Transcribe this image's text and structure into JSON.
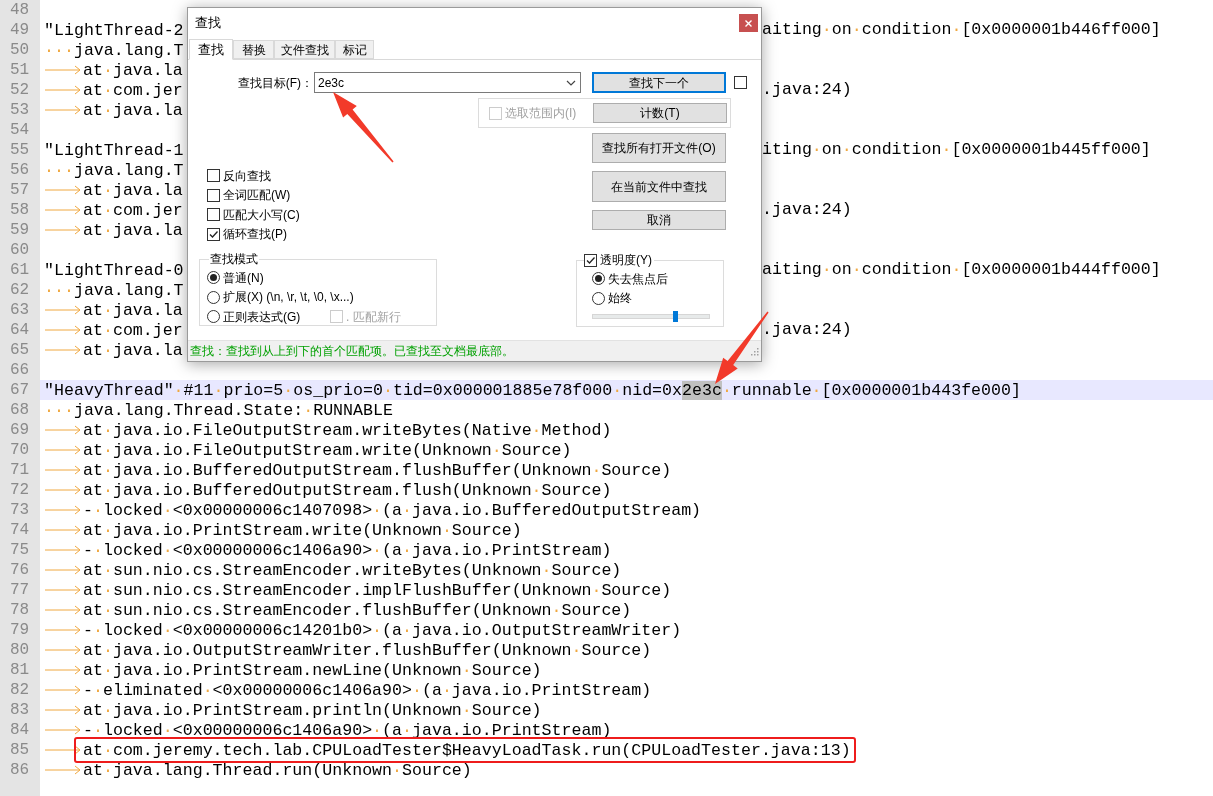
{
  "editor": {
    "lines": [
      {
        "number": "48",
        "tab": false,
        "current": false
      },
      {
        "number": "49",
        "tab": false,
        "current": false,
        "text": "\"LightThread-2",
        "right_text": "aiting·on·condition·[0x0000001b446ff000]"
      },
      {
        "number": "50",
        "tab": false,
        "current": false,
        "text": "···java.lang.T"
      },
      {
        "number": "51",
        "tab": true,
        "current": false,
        "text": "at·java.la"
      },
      {
        "number": "52",
        "tab": true,
        "current": false,
        "text": "at·com.jer",
        "right_text": ".java:24)"
      },
      {
        "number": "53",
        "tab": true,
        "current": false,
        "text": "at·java.la"
      },
      {
        "number": "54",
        "tab": false,
        "current": false
      },
      {
        "number": "55",
        "tab": false,
        "current": false,
        "text": "\"LightThread-1",
        "right_text": "iting·on·condition·[0x0000001b445ff000]"
      },
      {
        "number": "56",
        "tab": false,
        "current": false,
        "text": "···java.lang.T"
      },
      {
        "number": "57",
        "tab": true,
        "current": false,
        "text": "at·java.la"
      },
      {
        "number": "58",
        "tab": true,
        "current": false,
        "text": "at·com.jer",
        "right_text": ".java:24)"
      },
      {
        "number": "59",
        "tab": true,
        "current": false,
        "text": "at·java.la"
      },
      {
        "number": "60",
        "tab": false,
        "current": false
      },
      {
        "number": "61",
        "tab": false,
        "current": false,
        "text": "\"LightThread-0",
        "right_text": "aiting·on·condition·[0x0000001b444ff000]"
      },
      {
        "number": "62",
        "tab": false,
        "current": false,
        "text": "···java.lang.T"
      },
      {
        "number": "63",
        "tab": true,
        "current": false,
        "text": "at·java.la"
      },
      {
        "number": "64",
        "tab": true,
        "current": false,
        "text": "at·com.jer",
        "right_text": ".java:24)"
      },
      {
        "number": "65",
        "tab": true,
        "current": false,
        "text": "at·java.la"
      },
      {
        "number": "66",
        "tab": false,
        "current": false
      },
      {
        "number": "67",
        "tab": false,
        "current": true,
        "segments": [
          {
            "text": "\"HeavyThread\"·#11·prio=5·os_prio=0·tid=0x000001885e78f000·nid=0x",
            "match": false
          },
          {
            "text": "2e3c",
            "match": true
          },
          {
            "text": "·runnable·[0x0000001b443fe000]",
            "match": false
          }
        ]
      },
      {
        "number": "68",
        "tab": false,
        "current": false,
        "text": "···java.lang.Thread.State:·RUNNABLE"
      },
      {
        "number": "69",
        "tab": true,
        "current": false,
        "text": "at·java.io.FileOutputStream.writeBytes(Native·Method)"
      },
      {
        "number": "70",
        "tab": true,
        "current": false,
        "text": "at·java.io.FileOutputStream.write(Unknown·Source)"
      },
      {
        "number": "71",
        "tab": true,
        "current": false,
        "text": "at·java.io.BufferedOutputStream.flushBuffer(Unknown·Source)"
      },
      {
        "number": "72",
        "tab": true,
        "current": false,
        "text": "at·java.io.BufferedOutputStream.flush(Unknown·Source)"
      },
      {
        "number": "73",
        "tab": true,
        "current": false,
        "text": "-·locked·<0x00000006c1407098>·(a·java.io.BufferedOutputStream)"
      },
      {
        "number": "74",
        "tab": true,
        "current": false,
        "text": "at·java.io.PrintStream.write(Unknown·Source)"
      },
      {
        "number": "75",
        "tab": true,
        "current": false,
        "text": "-·locked·<0x00000006c1406a90>·(a·java.io.PrintStream)"
      },
      {
        "number": "76",
        "tab": true,
        "current": false,
        "text": "at·sun.nio.cs.StreamEncoder.writeBytes(Unknown·Source)"
      },
      {
        "number": "77",
        "tab": true,
        "current": false,
        "text": "at·sun.nio.cs.StreamEncoder.implFlushBuffer(Unknown·Source)"
      },
      {
        "number": "78",
        "tab": true,
        "current": false,
        "text": "at·sun.nio.cs.StreamEncoder.flushBuffer(Unknown·Source)"
      },
      {
        "number": "79",
        "tab": true,
        "current": false,
        "text": "-·locked·<0x00000006c14201b0>·(a·java.io.OutputStreamWriter)"
      },
      {
        "number": "80",
        "tab": true,
        "current": false,
        "text": "at·java.io.OutputStreamWriter.flushBuffer(Unknown·Source)"
      },
      {
        "number": "81",
        "tab": true,
        "current": false,
        "text": "at·java.io.PrintStream.newLine(Unknown·Source)"
      },
      {
        "number": "82",
        "tab": true,
        "current": false,
        "text": "-·eliminated·<0x00000006c1406a90>·(a·java.io.PrintStream)"
      },
      {
        "number": "83",
        "tab": true,
        "current": false,
        "text": "at·java.io.PrintStream.println(Unknown·Source)"
      },
      {
        "number": "84",
        "tab": true,
        "current": false,
        "text": "-·locked·<0x00000006c1406a90>·(a·java.io.PrintStream)"
      },
      {
        "number": "85",
        "tab": true,
        "current": false,
        "text": "at·com.jeremy.tech.lab.CPULoadTester$HeavyLoadTask.run(CPULoadTester.java:13)"
      },
      {
        "number": "86",
        "tab": true,
        "current": false,
        "text": "at·java.lang.Thread.run(Unknown·Source)"
      }
    ]
  },
  "find_dialog": {
    "title": "查找",
    "tabs": [
      {
        "label": "查找",
        "selected": true
      },
      {
        "label": "替换",
        "selected": false
      },
      {
        "label": "文件查找",
        "selected": false
      },
      {
        "label": "标记",
        "selected": false
      }
    ],
    "find_label": "查找目标(F)：",
    "find_value": "2e3c",
    "find_next_button": {
      "label": "查找下一个",
      "focused": true
    },
    "side_checkbox": {
      "checked": false
    },
    "in_selection": {
      "label": "选取范围内(I)",
      "checked": false,
      "disabled": true
    },
    "count_button": "计数(T)",
    "find_all_button": "查找所有打开文件(O)",
    "find_in_current_button": "在当前文件中查找",
    "cancel_button": "取消",
    "options": [
      {
        "label": "反向查找",
        "checked": false
      },
      {
        "label": "全词匹配(W)",
        "checked": false
      },
      {
        "label": "匹配大小写(C)",
        "checked": false
      },
      {
        "label": "循环查找(P)",
        "checked": true
      }
    ],
    "search_mode": {
      "title": "查找模式",
      "options": [
        {
          "label": "普通(N)",
          "selected": true
        },
        {
          "label": "扩展(X) (\\n, \\r, \\t, \\0, \\x...)",
          "selected": false
        },
        {
          "label": "正则表达式(G)",
          "selected": false
        }
      ],
      "dot_newline": {
        "label": ". 匹配新行",
        "checked": false,
        "disabled": true
      }
    },
    "transparency": {
      "label": "透明度(Y)",
      "checked": true,
      "options": [
        {
          "label": "失去焦点后",
          "selected": true
        },
        {
          "label": "始终",
          "selected": false
        }
      ],
      "level": 0.71
    },
    "status": "查找：查找到从上到下的首个匹配项。已查找至文档最底部。"
  },
  "annotations": [
    {
      "kind": "arrow"
    },
    {
      "kind": "arrow"
    },
    {
      "kind": "box"
    }
  ]
}
